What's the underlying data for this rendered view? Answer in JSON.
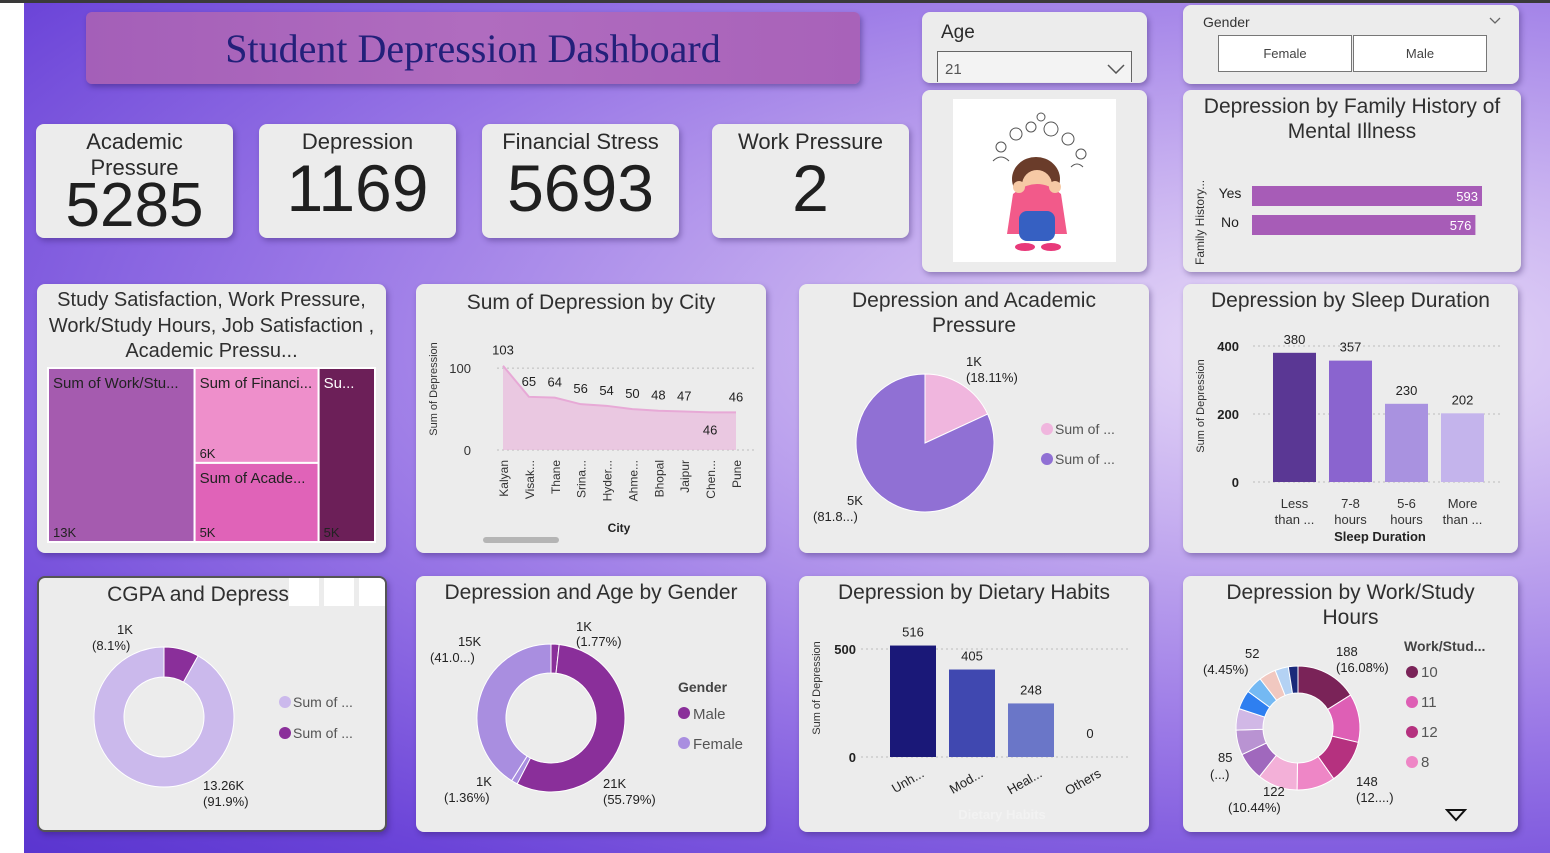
{
  "header": {
    "title": "Student Depression Dashboard"
  },
  "kpis": [
    {
      "label": "Academic Pressure",
      "value": "5285"
    },
    {
      "label": "Depression",
      "value": "1169"
    },
    {
      "label": "Financial Stress",
      "value": "5693"
    },
    {
      "label": "Work Pressure",
      "value": "2"
    }
  ],
  "filters": {
    "age": {
      "label": "Age",
      "value": "21"
    },
    "gender": {
      "label": "Gender",
      "options": [
        "Female",
        "Male"
      ]
    }
  },
  "colors": {
    "accent": "#a45fb8",
    "title_text": "#23207a"
  },
  "chart_data": [
    {
      "id": "family-history",
      "type": "bar",
      "orientation": "horizontal",
      "title": "Depression by Family History of Mental Illness",
      "ylabel": "Family History...",
      "categories": [
        "Yes",
        "No"
      ],
      "values": [
        593,
        576
      ],
      "data_labels": [
        "593",
        "576"
      ],
      "color": "#a75cb7"
    },
    {
      "id": "treemap",
      "type": "treemap",
      "title": "Study Satisfaction, Work Pressure, Work/Study Hours, Job Satisfaction , Academic Pressu...",
      "items": [
        {
          "label": "Sum of Work/Stu...",
          "value_label": "13K",
          "value": 13,
          "color": "#a55baf"
        },
        {
          "label": "Sum of Financi...",
          "value_label": "6K",
          "value": 6,
          "color": "#ee8fcb"
        },
        {
          "label": "Sum of Acade...",
          "value_label": "5K",
          "value": 5,
          "color": "#e063b8"
        },
        {
          "label": "Su...",
          "value_label": "5K",
          "value": 5,
          "color": "#6c1f58"
        }
      ]
    },
    {
      "id": "city",
      "type": "area",
      "title": "Sum of Depression by City",
      "xlabel": "City",
      "ylabel": "Sum of Depression",
      "categories": [
        "Kalyan",
        "Visak...",
        "Thane",
        "Srina...",
        "Hyder...",
        "Ahme...",
        "Bhopal",
        "Jaipur",
        "Chen...",
        "Pune"
      ],
      "values": [
        103,
        65,
        64,
        56,
        54,
        50,
        48,
        47,
        46,
        46
      ],
      "ylim": [
        0,
        110
      ],
      "yticks": [
        "0",
        "100"
      ],
      "color": "#e9b6dc"
    },
    {
      "id": "academic-pie",
      "type": "pie",
      "title": "Depression and Academic Pressure",
      "slices": [
        {
          "label": "1K",
          "pct_label": "(18.11%)",
          "value": 18.11,
          "color": "#f0b6de"
        },
        {
          "label": "5K",
          "pct_label": "(81.8...)",
          "value": 81.89,
          "color": "#9070d4"
        }
      ],
      "legend": [
        "Sum of ...",
        "Sum of ..."
      ]
    },
    {
      "id": "sleep",
      "type": "bar",
      "title": "Depression by Sleep Duration",
      "xlabel": "Sleep Duration",
      "ylabel": "Sum of Depression",
      "categories": [
        [
          "Less",
          "than ..."
        ],
        [
          "7-8",
          "hours"
        ],
        [
          "5-6",
          "hours"
        ],
        [
          "More",
          "than ..."
        ]
      ],
      "values": [
        380,
        357,
        230,
        202
      ],
      "colors": [
        "#5a3794",
        "#8a64cf",
        "#a992e0",
        "#c4b4ec"
      ],
      "ylim": [
        0,
        420
      ],
      "yticks": [
        "0",
        "200",
        "400"
      ]
    },
    {
      "id": "cgpa",
      "type": "donut",
      "title": "CGPA and Depression",
      "slices": [
        {
          "label": "1K",
          "pct_label": "(8.1%)",
          "value": 8.1,
          "color": "#8a2f9a"
        },
        {
          "label": "13.26K",
          "pct_label": "(91.9%)",
          "value": 91.9,
          "color": "#cbb9ec"
        }
      ],
      "legend": [
        {
          "label": "Sum of ...",
          "color": "#cbb9ec"
        },
        {
          "label": "Sum of ...",
          "color": "#8a2f9a"
        }
      ]
    },
    {
      "id": "age-gender",
      "type": "donut",
      "title": "Depression and Age by Gender",
      "legend_title": "Gender",
      "slices": [
        {
          "label": "1K",
          "pct_label": "(1.77%)",
          "value": 1.77,
          "color": "#8a2f9a"
        },
        {
          "label": "21K",
          "pct_label": "(55.79%)",
          "value": 55.79,
          "color": "#8a2f9a"
        },
        {
          "label": "1K",
          "pct_label": "(1.36%)",
          "value": 1.36,
          "color": "#a98ee0"
        },
        {
          "label": "15K",
          "pct_label": "(41.0...)",
          "value": 41.08,
          "color": "#a98ee0"
        }
      ],
      "legend": [
        {
          "label": "Male",
          "color": "#8a2f9a"
        },
        {
          "label": "Female",
          "color": "#a98ee0"
        }
      ]
    },
    {
      "id": "dietary",
      "type": "bar",
      "title": "Depression by Dietary Habits",
      "xlabel": "Dietary Habits",
      "ylabel": "Sum of Depression",
      "categories": [
        "Unh...",
        "Mod...",
        "Heal...",
        "Others"
      ],
      "values": [
        516,
        405,
        248,
        0
      ],
      "colors": [
        "#1a1878",
        "#4048b0",
        "#6a76c8",
        "#8a96d8"
      ],
      "ylim": [
        0,
        560
      ],
      "yticks": [
        "0",
        "500"
      ]
    },
    {
      "id": "workstudy",
      "type": "donut",
      "title": "Depression by Work/Study Hours",
      "legend_title": "Work/Stud...",
      "slices": [
        {
          "label": "188",
          "pct_label": "(16.08%)",
          "value": 16.08,
          "color": "#7a2358"
        },
        {
          "label": "148",
          "pct_label": "(12....)",
          "value": 12.66,
          "color": "#de5fb5"
        },
        {
          "label": "",
          "pct_label": "",
          "value": 11.5,
          "color": "#b5317f"
        },
        {
          "label": "",
          "pct_label": "",
          "value": 10.0,
          "color": "#ee86c6"
        },
        {
          "label": "122",
          "pct_label": "(10.44%)",
          "value": 10.44,
          "color": "#f3b0d8"
        },
        {
          "label": "85",
          "pct_label": "(...)",
          "value": 7.27,
          "color": "#a068bd"
        },
        {
          "label": "",
          "pct_label": "",
          "value": 6.5,
          "color": "#b993d2"
        },
        {
          "label": "",
          "pct_label": "",
          "value": 5.6,
          "color": "#d1b8e6"
        },
        {
          "label": "",
          "pct_label": "",
          "value": 5.0,
          "color": "#2e7ff0"
        },
        {
          "label": "",
          "pct_label": "",
          "value": 4.5,
          "color": "#74b9f3"
        },
        {
          "label": "52",
          "pct_label": "(4.45%)",
          "value": 4.45,
          "color": "#f1c8c0"
        },
        {
          "label": "",
          "pct_label": "",
          "value": 3.5,
          "color": "#b4d2f4"
        },
        {
          "label": "",
          "pct_label": "",
          "value": 2.5,
          "color": "#1b2a7a"
        }
      ],
      "legend": [
        {
          "label": "10",
          "color": "#7a2358"
        },
        {
          "label": "11",
          "color": "#de5fb5"
        },
        {
          "label": "12",
          "color": "#b5317f"
        },
        {
          "label": "8",
          "color": "#ee86c6"
        }
      ]
    }
  ]
}
